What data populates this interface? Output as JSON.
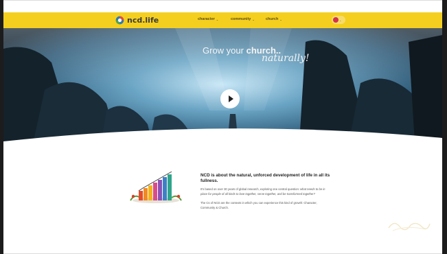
{
  "brand": {
    "name": "ncd.life"
  },
  "nav": {
    "items": [
      {
        "label": "character",
        "chevron": "chevron-down-icon"
      },
      {
        "label": "community",
        "chevron": "chevron-down-icon"
      },
      {
        "label": "church",
        "chevron": "chevron-down-icon"
      }
    ],
    "language": {
      "icon": "flag-icon",
      "chevron": "chevron-down-icon"
    }
  },
  "hero": {
    "headline_prefix": "Grow your",
    "headline_emphasis": "church..",
    "headline_script": "naturally!",
    "play_icon": "play-icon"
  },
  "content": {
    "heading": "NCD is about the natural, unforced development of life in all its fullness.",
    "para1_prefix": "It's based on over 30 years of global research, exploring one central question:",
    "para1_italic": "what needs to be in place for people of all kinds to love together, serve together, and be transformed together?",
    "para2": "The Cs of NCD are the contexts in which you can experience this kind of growth: Character, Community & Church."
  },
  "colors": {
    "navbar": "#f4cf1f",
    "hero_blue": "#3e6a86",
    "text_dark": "#222222"
  }
}
